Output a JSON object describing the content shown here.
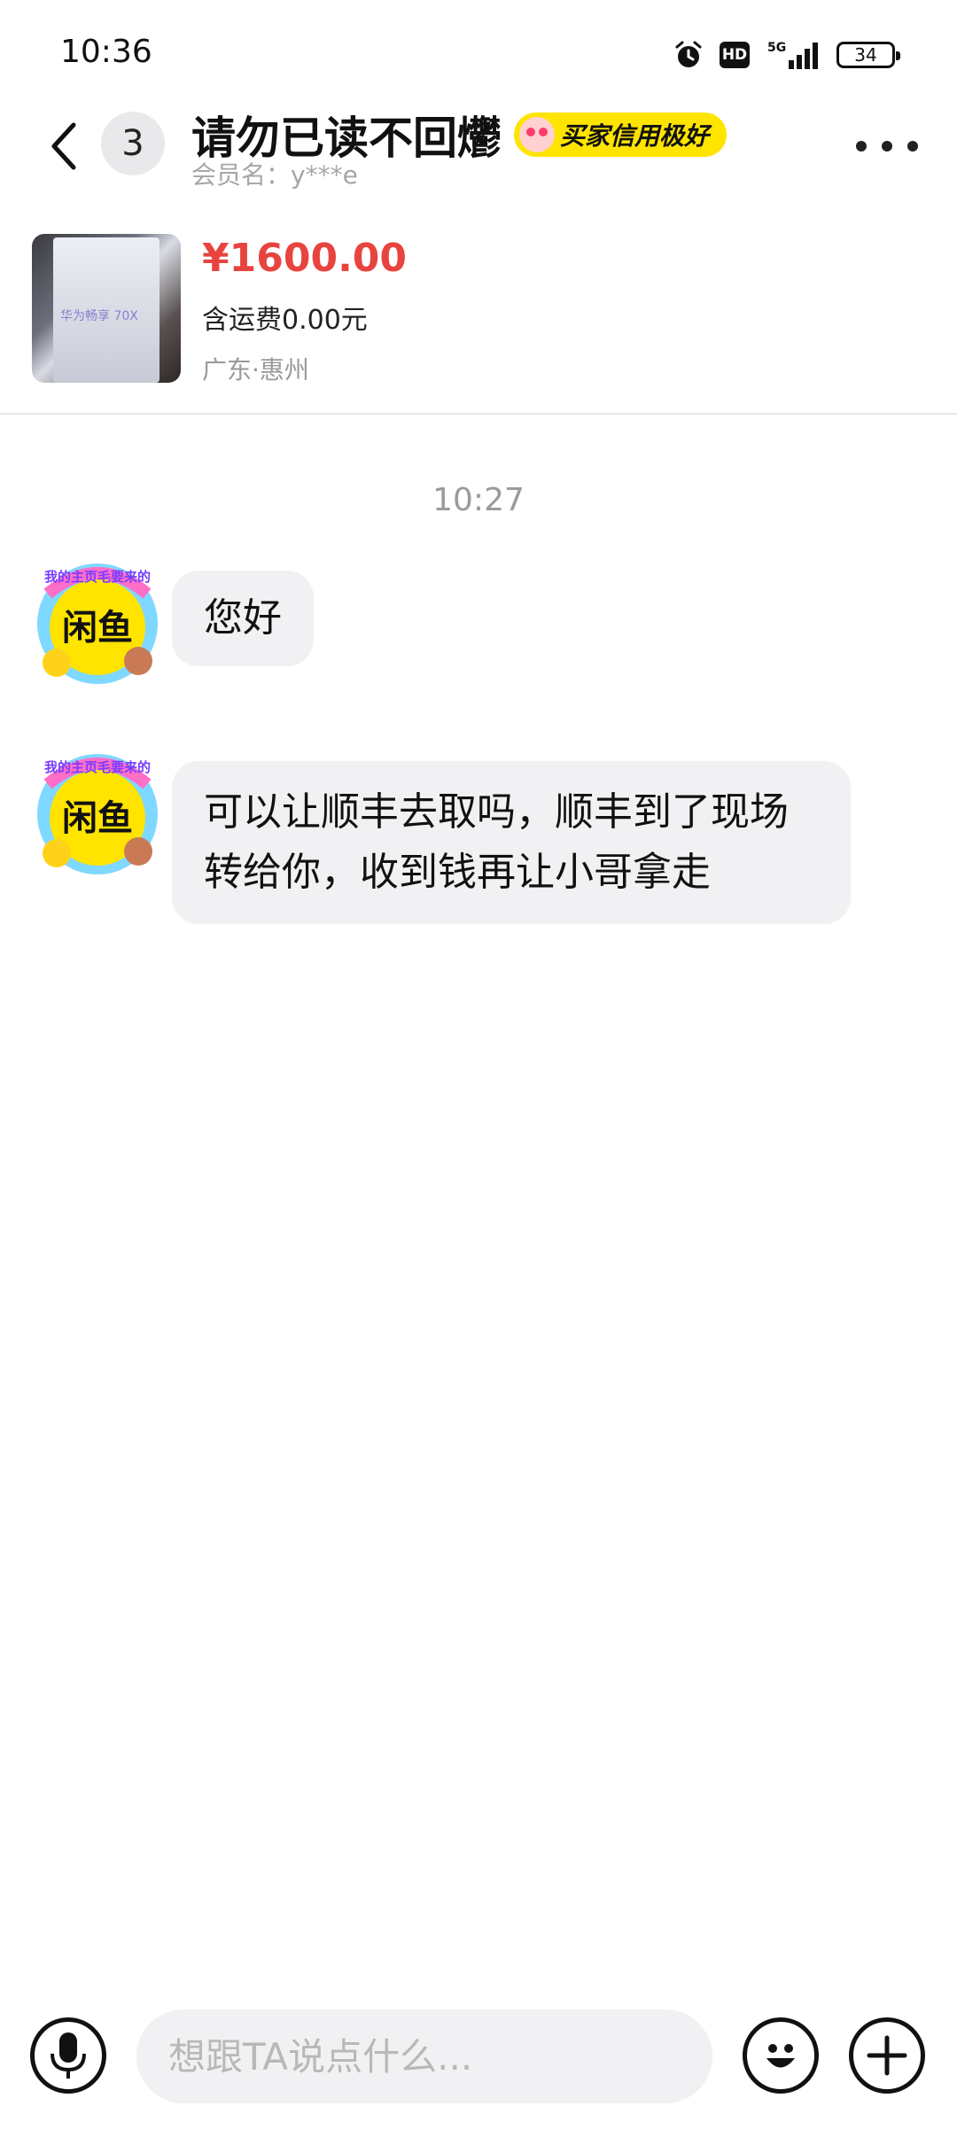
{
  "status_bar": {
    "time": "10:36",
    "icons": [
      "alarm-icon",
      "hd-icon",
      "5g-signal-icon",
      "battery-icon"
    ],
    "hd_label": "HD",
    "network_label": "5G",
    "battery_level": "34"
  },
  "header": {
    "back_icon": "chevron-left-icon",
    "unread_count": "3",
    "title": "请勿已读不回爩",
    "credit_badge": "买家信用极好",
    "member_label": "会员名：y***e",
    "more_icon": "more-horizontal-icon"
  },
  "product": {
    "thumbnail_text": "华为畅享 70X",
    "price": "¥1600.00",
    "shipping": "含运费0.00元",
    "location": "广东·惠州"
  },
  "chat": {
    "timestamp": "10:27",
    "messages": [
      {
        "sender": "other",
        "text": "您好"
      },
      {
        "sender": "other",
        "text": "可以让顺丰去取吗，顺丰到了现场转给你，收到钱再让小哥拿走"
      }
    ],
    "avatar_sticker_text": "我的主页毛要来的",
    "avatar_logo_text": "闲鱼"
  },
  "input_bar": {
    "placeholder": "想跟TA说点什么...",
    "value": "",
    "voice_icon": "microphone-icon",
    "emoji_icon": "smiley-icon",
    "plus_icon": "plus-icon"
  },
  "colors": {
    "price": "#e8443f",
    "credit_badge_bg": "#ffe400",
    "bubble_bg": "#f1f1f3",
    "muted_text": "#9a9a9a"
  }
}
